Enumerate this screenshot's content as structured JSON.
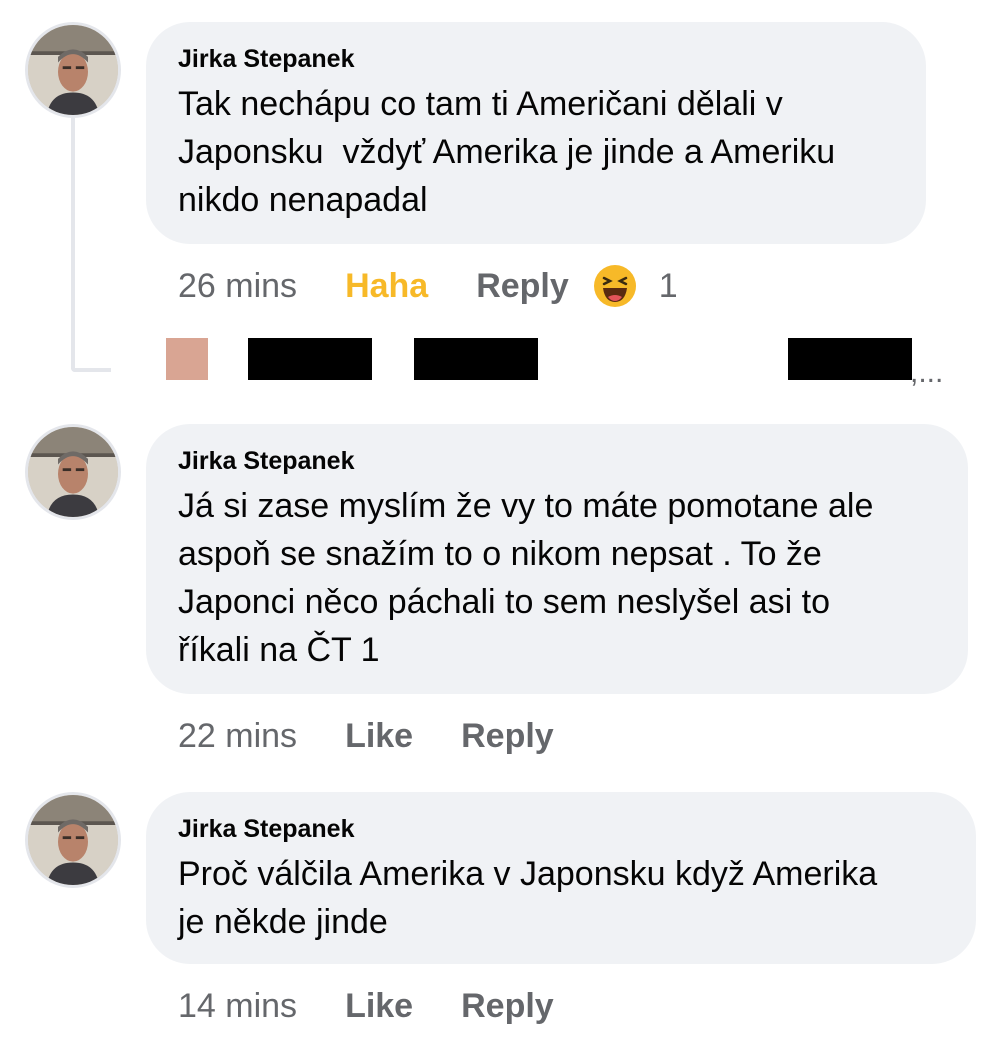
{
  "comments": [
    {
      "author": "Jirka Stepanek",
      "text": "Tak nechápu co tam ti Američani dělali v\nJaponsku  vždyť Amerika je jinde a Ameriku\nnikdo nenapadal",
      "time": "26 mins",
      "reaction_label": "Haha",
      "reply_label": "Reply",
      "reaction_icon": "haha-emoji-icon",
      "reaction_count": "1"
    },
    {
      "author": "Jirka Stepanek",
      "text": "Já si zase myslím že vy to máte pomotane ale\naspoň se snažím to o nikom nepsat . To že\nJaponci něco páchali to sem neslyšel asi to\nříkali na ČT 1",
      "time": "22 mins",
      "like_label": "Like",
      "reply_label": "Reply"
    },
    {
      "author": "Jirka Stepanek",
      "text": "Proč válčila Amerika v Japonsku když Amerika\nje někde jinde",
      "time": "14 mins",
      "like_label": "Like",
      "reply_label": "Reply"
    }
  ],
  "redacted_reply_row": {
    "ellipsis": ",..."
  },
  "colors": {
    "bubble_bg": "#f0f2f5",
    "haha_yellow": "#f7b928",
    "meta_gray": "#65676b"
  }
}
